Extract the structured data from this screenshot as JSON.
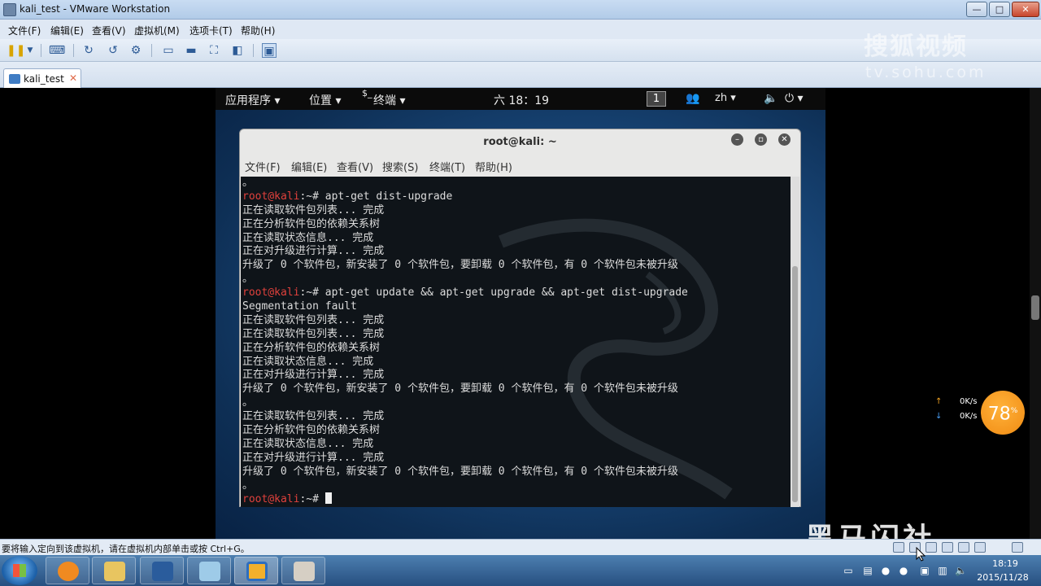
{
  "window": {
    "title": "kali_test - VMware Workstation",
    "controls": {
      "minimize": "—",
      "maximize": "□",
      "close": "✕"
    }
  },
  "menubar": [
    "文件(F)",
    "编辑(E)",
    "查看(V)",
    "虚拟机(M)",
    "选项卡(T)",
    "帮助(H)"
  ],
  "toolbar_icons": [
    "pause-icon",
    "dropdown-icon",
    "send-keys-icon",
    "snapshot-icon",
    "revert-snapshot-icon",
    "snapshot-manager-icon",
    "normal-view-icon",
    "console-view-icon",
    "fullscreen-icon",
    "unity-icon",
    "thumbnail-icon"
  ],
  "tab": {
    "label": "kali_test",
    "close": "✕"
  },
  "gnome_bar": {
    "apps": "应用程序 ▾",
    "places": "位置 ▾",
    "terminal": "终端 ▾",
    "terminal_prefix": "$_",
    "clock": "六 18：19",
    "workspace": "1",
    "lang": "zh ▾",
    "power": "⏻ ▾"
  },
  "terminal": {
    "title": "root@kali: ~",
    "menu": [
      "文件(F)",
      "编辑(E)",
      "查看(V)",
      "搜索(S)",
      "终端(T)",
      "帮助(H)"
    ],
    "prompt_user": "root@kali",
    "prompt_path": ":~#",
    "lines": [
      {
        "type": "text",
        "text": "。"
      },
      {
        "type": "prompt",
        "cmd": " apt-get dist-upgrade"
      },
      {
        "type": "text",
        "text": "正在读取软件包列表... 完成"
      },
      {
        "type": "text",
        "text": "正在分析软件包的依赖关系树"
      },
      {
        "type": "text",
        "text": "正在读取状态信息... 完成"
      },
      {
        "type": "text",
        "text": "正在对升级进行计算... 完成"
      },
      {
        "type": "text",
        "text": "升级了 0 个软件包，新安装了 0 个软件包，要卸载 0 个软件包，有 0 个软件包未被升级"
      },
      {
        "type": "text",
        "text": "。"
      },
      {
        "type": "prompt",
        "cmd": " apt-get update && apt-get upgrade && apt-get dist-upgrade"
      },
      {
        "type": "text",
        "text": "Segmentation fault"
      },
      {
        "type": "text",
        "text": "正在读取软件包列表... 完成"
      },
      {
        "type": "text",
        "text": "正在读取软件包列表... 完成"
      },
      {
        "type": "text",
        "text": "正在分析软件包的依赖关系树"
      },
      {
        "type": "text",
        "text": "正在读取状态信息... 完成"
      },
      {
        "type": "text",
        "text": "正在对升级进行计算... 完成"
      },
      {
        "type": "text",
        "text": "升级了 0 个软件包，新安装了 0 个软件包，要卸载 0 个软件包，有 0 个软件包未被升级"
      },
      {
        "type": "text",
        "text": "。"
      },
      {
        "type": "text",
        "text": "正在读取软件包列表... 完成"
      },
      {
        "type": "text",
        "text": "正在分析软件包的依赖关系树"
      },
      {
        "type": "text",
        "text": "正在读取状态信息... 完成"
      },
      {
        "type": "text",
        "text": "正在对升级进行计算... 完成"
      },
      {
        "type": "text",
        "text": "升级了 0 个软件包，新安装了 0 个软件包，要卸载 0 个软件包，有 0 个软件包未被升级"
      },
      {
        "type": "text",
        "text": "。"
      },
      {
        "type": "prompt_cursor",
        "cmd": " "
      }
    ]
  },
  "statusbar": {
    "text": "要将输入定向到该虚拟机，请在虚拟机内部单击或按 Ctrl+G。"
  },
  "taskbar": {
    "apps": [
      "browser",
      "file-explorer",
      "media-player",
      "notepad",
      "vmware",
      "image-viewer"
    ],
    "clock_time": "18:19",
    "clock_date": "2015/11/28"
  },
  "overlays": {
    "sohu_cn": "搜狐视频",
    "sohu_en": "tv.sohu.com",
    "heima": "黑马闪社",
    "net_up": "0K/s",
    "net_down": "0K/s",
    "net_percent": "78",
    "net_percent_unit": "%"
  }
}
